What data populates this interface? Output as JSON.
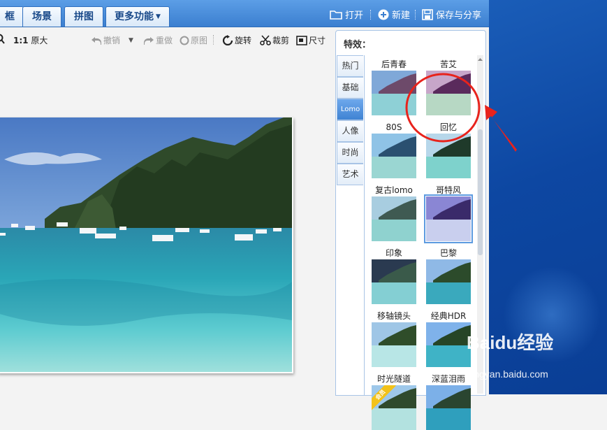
{
  "topbar": {
    "tabs": [
      {
        "label": "框"
      },
      {
        "label": "场景"
      },
      {
        "label": "拼图"
      },
      {
        "label": "更多功能"
      }
    ],
    "open_label": "打开",
    "new_label": "新建",
    "save_share_label": "保存与分享"
  },
  "toolbar": {
    "ratio_label": "1:1",
    "original_size_label": "原大",
    "undo_label": "撤销",
    "redo_label": "重做",
    "original_label": "原图",
    "rotate_label": "旋转",
    "crop_label": "裁剪",
    "size_label": "尺寸"
  },
  "panel": {
    "title": "特效：",
    "categories": [
      {
        "label": "热门",
        "active": false
      },
      {
        "label": "基础",
        "active": false
      },
      {
        "label": "Lomo",
        "active": true
      },
      {
        "label": "人像",
        "active": false
      },
      {
        "label": "时尚",
        "active": false
      },
      {
        "label": "艺术",
        "active": false
      }
    ],
    "effects": [
      {
        "label": "后青春"
      },
      {
        "label": "苦艾"
      },
      {
        "label": "80S"
      },
      {
        "label": "回忆"
      },
      {
        "label": "复古lomo"
      },
      {
        "label": "哥特风",
        "selected": true
      },
      {
        "label": "印象"
      },
      {
        "label": "巴黎"
      },
      {
        "label": "移轴镜头"
      },
      {
        "label": "经典HDR"
      },
      {
        "label": "时光隧道",
        "badge": "会员"
      },
      {
        "label": "深蓝泪雨"
      }
    ]
  },
  "watermark": {
    "brand": "Baidu经验",
    "url": "jingyan.baidu.com"
  },
  "colors": {
    "topbar": "#3b7fd0",
    "accent": "#3f83d3",
    "annotation": "#e8231c",
    "desktop": "#0d47a2"
  }
}
